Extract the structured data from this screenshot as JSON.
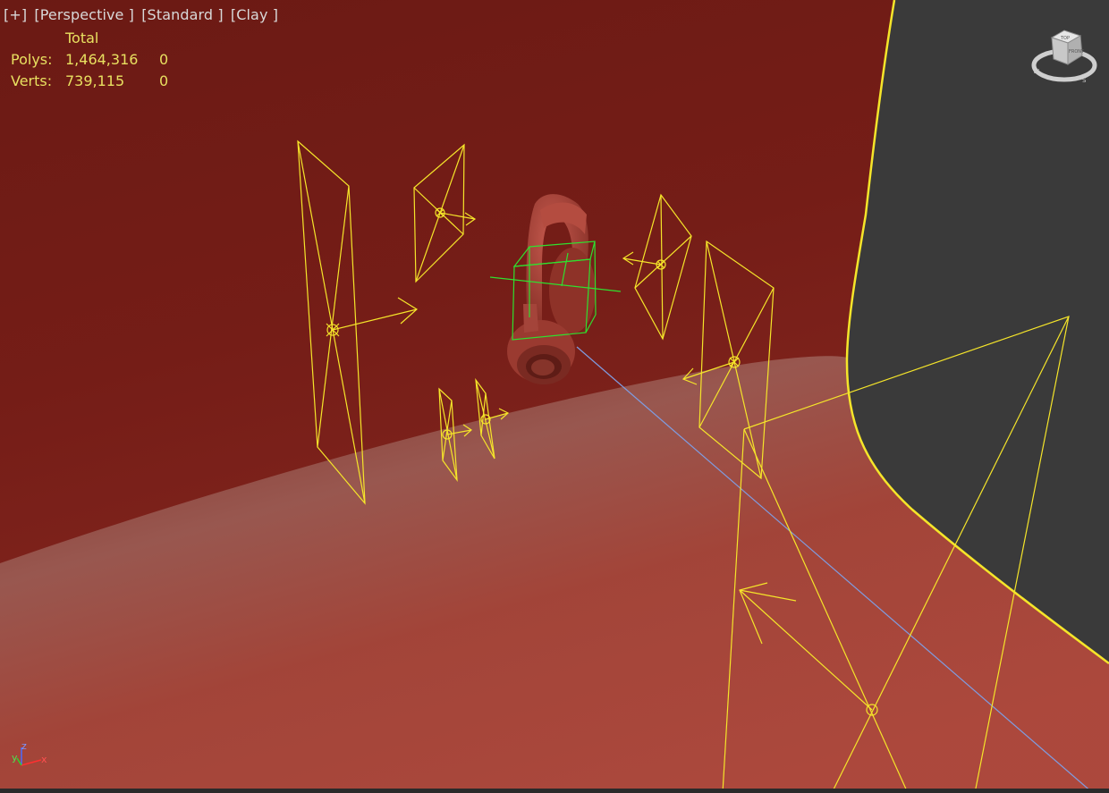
{
  "viewport": {
    "labels": [
      "[+]",
      "[Perspective ]",
      "[Standard ]",
      "[Clay ]"
    ]
  },
  "stats": {
    "header": "Total",
    "polys": {
      "label": "Polys:",
      "total": "1,464,316",
      "selected": "0"
    },
    "verts": {
      "label": "Verts:",
      "total": "739,115",
      "selected": "0"
    }
  },
  "viewcube": {
    "face_top": "TOP",
    "face_front": "FRONT",
    "compass": [
      "W",
      "S"
    ]
  },
  "axis": {
    "z": "z",
    "y": "y",
    "x": "x"
  },
  "colors": {
    "backdrop_dark": "#6b1a14",
    "floor_light": "#b04a3e",
    "selection_yellow": "#f5e52a",
    "gizmo_green": "#2fe02f",
    "view_gray": "#3a3a3a",
    "target_line_blue": "#7f9ce0"
  }
}
